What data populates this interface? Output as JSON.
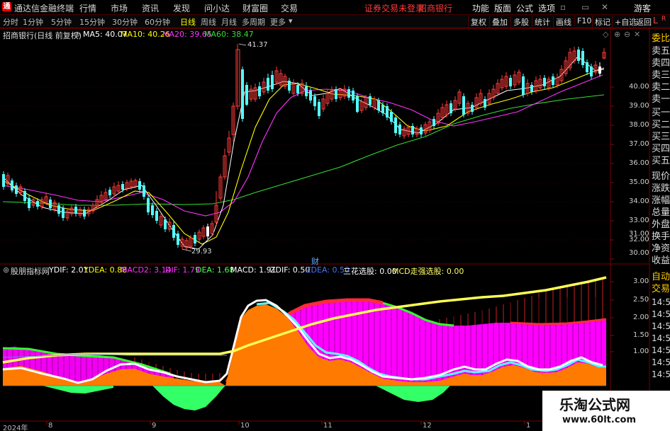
{
  "menubar": {
    "app_title": "通达信金融终端",
    "items": [
      "行情",
      "市场",
      "资讯",
      "发现",
      "问小达",
      "财富圈",
      "交易"
    ],
    "notice": "证券交易未登录",
    "stock_name": "招商银行",
    "right_items": [
      "功能",
      "版面",
      "公式",
      "选项"
    ],
    "guest": "游客"
  },
  "toolbar": {
    "tabs": [
      "分时",
      "1分钟",
      "5分钟",
      "15分钟",
      "30分钟",
      "60分钟",
      "日线",
      "周线",
      "月线",
      "多周期",
      "更多"
    ],
    "active": "日线",
    "right_buttons": [
      "复权",
      "叠加",
      "多股",
      "统计",
      "画线",
      "F10",
      "标记",
      "+自选",
      "返回"
    ]
  },
  "main_info": {
    "title": "招商银行(日线 前复权)",
    "ma5": "MA5: 40.07",
    "ma10": "MA10: 40.26",
    "ma20": "MA20: 39.65",
    "ma60": "MA60: 38.47"
  },
  "price_axis": [
    "40.00",
    "39.00",
    "38.00",
    "37.00",
    "36.00",
    "35.00",
    "34.00",
    "33.00",
    "32.00",
    "31.00",
    "30.00"
  ],
  "annotations": {
    "high": "41.37",
    "low": "29.93",
    "cai": "财"
  },
  "indicator_info": {
    "title": "股朋指标网",
    "ydif": "YDIF: 2.01",
    "ydea": "YDEA: 0.88",
    "macd2": "MACD2: 3.14",
    "dif": "DIF: 1.79",
    "dea": "DEA: 1.68",
    "macd": "MACD: 1.91",
    "zdif": "ZDIF: 0.50",
    "zdea": "ZDEA: 0.50",
    "sanhua": "三花选股: 0.00",
    "mcd": "MCD走强选股: 0.00"
  },
  "indicator_axis": [
    "3.00",
    "2.50",
    "2.00",
    "1.50",
    "1.00"
  ],
  "sidebar_top": [
    "委比",
    "卖五",
    "卖四",
    "卖三",
    "卖二",
    "卖一",
    "买一",
    "买二",
    "买三",
    "买四",
    "买五",
    "现价",
    "涨跌",
    "涨幅",
    "总量",
    "外盘",
    "换手",
    "净资",
    "收益"
  ],
  "sidebar_bottom": [
    "自动",
    "交易",
    "14:56",
    "14:56",
    "14:56",
    "14:56",
    "14:56",
    "14:56",
    "14:56"
  ],
  "dates": [
    "2024年",
    "8",
    "9",
    "10",
    "11",
    "12",
    "1"
  ],
  "watermark": {
    "name": "乐淘公式网",
    "url": "www.60lt.com"
  },
  "colors": {
    "up": "#ff3a3a",
    "down": "#54ffff",
    "ma5": "#ffffff",
    "ma10": "#ffff00",
    "ma20": "#ff33ff",
    "ma60": "#33dd33",
    "magenta_bar": "#ff00ff",
    "orange_area": "#ff7a00",
    "green_area": "#33ff66",
    "yellow_line": "#ffff66"
  },
  "chart_data": {
    "type": "line",
    "title": "招商银行(日线 前复权)",
    "ylim": [
      29.7,
      41.7
    ],
    "series": [
      {
        "name": "MA5",
        "value": 40.07
      },
      {
        "name": "MA10",
        "value": 40.26
      },
      {
        "name": "MA20",
        "value": 39.65
      },
      {
        "name": "MA60",
        "value": 38.47
      }
    ],
    "high": 41.37,
    "low": 29.93
  }
}
